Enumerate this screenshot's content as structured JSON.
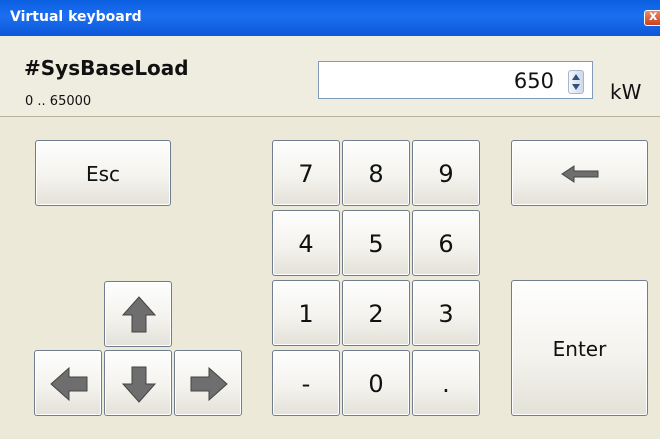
{
  "window": {
    "title": "Virtual keyboard",
    "close_glyph": "x"
  },
  "variable": {
    "name": "#SysBaseLoad",
    "range": "0 .. 65000"
  },
  "input": {
    "value": "650",
    "unit": "kW"
  },
  "keys": {
    "esc": "Esc",
    "enter": "Enter",
    "digits": [
      "7",
      "8",
      "9",
      "4",
      "5",
      "6",
      "1",
      "2",
      "3",
      "-",
      "0",
      "."
    ]
  },
  "icons": {
    "backspace": "backspace-arrow-icon",
    "up": "arrow-up-icon",
    "down": "arrow-down-icon",
    "left": "arrow-left-icon",
    "right": "arrow-right-icon",
    "spinner": "spinner-icon"
  },
  "colors": {
    "titlebar": "#0a5fe0",
    "window_bg": "#ece9d8",
    "arrow_fill": "#6e6e6e"
  }
}
